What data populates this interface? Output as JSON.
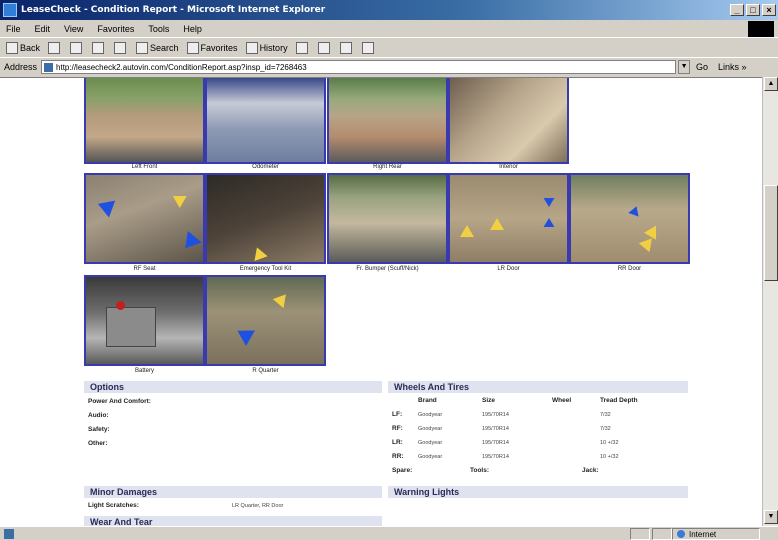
{
  "window": {
    "title": "LeaseCheck - Condition Report - Microsoft Internet Explorer",
    "controls": [
      "_",
      "□",
      "×"
    ]
  },
  "menu": [
    "File",
    "Edit",
    "View",
    "Favorites",
    "Tools",
    "Help"
  ],
  "toolbar": {
    "back": "Back",
    "search": "Search",
    "favorites": "Favorites",
    "history": "History"
  },
  "address": {
    "label": "Address",
    "url": "http://leasecheck2.autovin.com/ConditionReport.asp?insp_id=7268463",
    "go": "Go",
    "links": "Links »"
  },
  "photos": [
    {
      "caption": "Left Front"
    },
    {
      "caption": "Odometer"
    },
    {
      "caption": "Right Rear"
    },
    {
      "caption": "Interior"
    },
    {
      "caption": "RF Seat"
    },
    {
      "caption": "Emergency Tool Kit"
    },
    {
      "caption": "Fr. Bumper (Scuff/Nick)"
    },
    {
      "caption": "LR Door"
    },
    {
      "caption": "RR Door"
    },
    {
      "caption": "Battery"
    },
    {
      "caption": "R Quarter"
    }
  ],
  "options": {
    "header": "Options",
    "rows": [
      "Power And Comfort:",
      "Audio:",
      "Safety:",
      "Other:"
    ]
  },
  "wheels": {
    "header": "Wheels And Tires",
    "columns": [
      "Brand",
      "Size",
      "Wheel",
      "Tread Depth"
    ],
    "rows": [
      {
        "pos": "LF:",
        "brand": "Goodyear",
        "size": "195/70R14",
        "wheel": "",
        "tread": "7/32"
      },
      {
        "pos": "RF:",
        "brand": "Goodyear",
        "size": "195/70R14",
        "wheel": "",
        "tread": "7/32"
      },
      {
        "pos": "LR:",
        "brand": "Goodyear",
        "size": "195/70R14",
        "wheel": "",
        "tread": "10 +/32"
      },
      {
        "pos": "RR:",
        "brand": "Goodyear",
        "size": "195/70R14",
        "wheel": "",
        "tread": "10 +/32"
      }
    ],
    "spare": "Spare:",
    "tools": "Tools:",
    "jack": "Jack:"
  },
  "minor_damages": {
    "header": "Minor Damages",
    "label": "Light Scratches:",
    "value": "LR Quarter, RR Door"
  },
  "warning_lights": {
    "header": "Warning Lights"
  },
  "wear_and_tear": {
    "header": "Wear And Tear"
  },
  "status": {
    "zone": "Internet"
  },
  "colors": {
    "photo_border": "#3a3ab0",
    "section_bg": "#dfe3f0",
    "title_bar": "#0a246a"
  }
}
